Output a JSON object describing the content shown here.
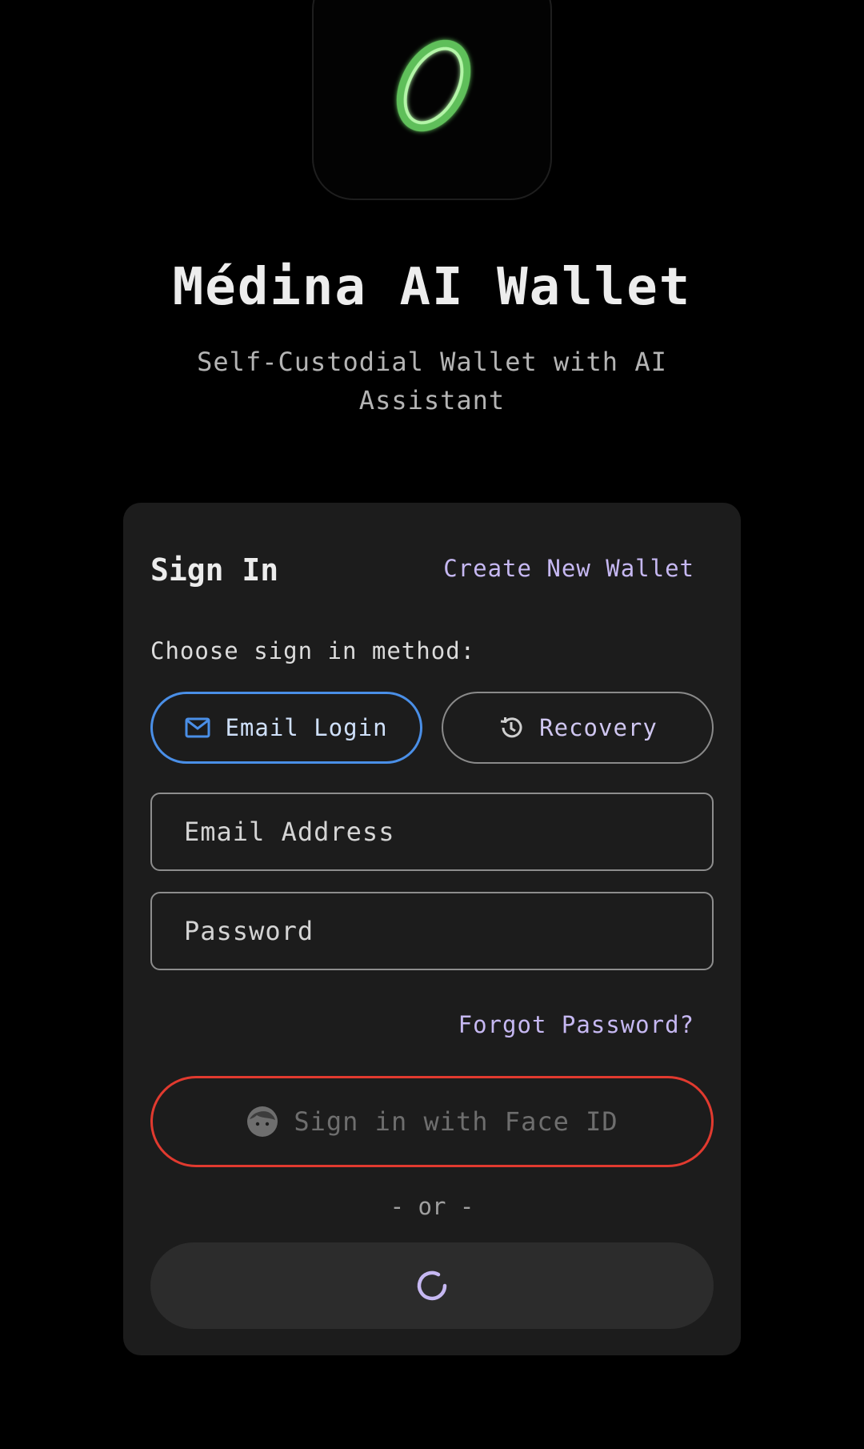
{
  "app": {
    "title": "Médina AI Wallet",
    "subtitle": "Self-Custodial Wallet with AI Assistant"
  },
  "sign_in": {
    "heading": "Sign In",
    "create_wallet_link": "Create New Wallet",
    "method_label": "Choose sign in method:",
    "methods": [
      {
        "label": "Email Login",
        "icon": "mail-icon",
        "selected": true
      },
      {
        "label": "Recovery",
        "icon": "history-icon",
        "selected": false
      }
    ],
    "email_placeholder": "Email Address",
    "email_value": "",
    "password_placeholder": "Password",
    "password_value": "",
    "forgot_link": "Forgot Password?",
    "face_id_label": "Sign in with Face ID",
    "divider": "- or -"
  },
  "colors": {
    "background": "#000000",
    "card": "#1c1c1c",
    "link": "#c6b8f2",
    "selected_border": "#4a8fe7",
    "face_id_border": "#e13a2f",
    "logo_glow": "#7ee07a",
    "spinner": "#c6b8f2"
  }
}
